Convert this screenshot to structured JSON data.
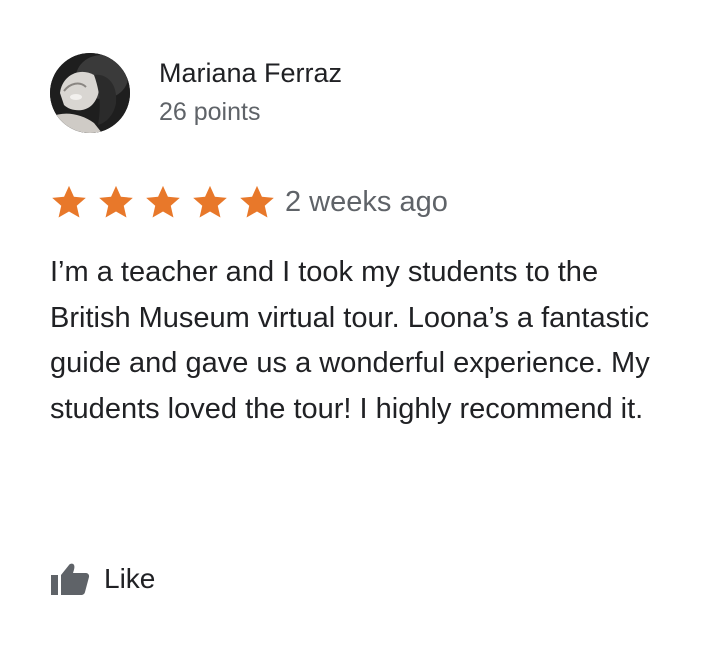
{
  "review": {
    "author": {
      "name": "Mariana Ferraz",
      "points": "26 points",
      "avatar_icon": "user-avatar-photo"
    },
    "rating": {
      "stars": 5,
      "max_stars": 5,
      "star_color": "#e8782a",
      "star_icon": "star-icon"
    },
    "date": "2 weeks ago",
    "text": "I’m a teacher and I took my students to the British Museum virtual tour. Loona’s a fantastic guide and gave us a wonderful experience. My students loved the tour! I highly recommend it.",
    "like": {
      "label": "Like",
      "icon": "thumbs-up-icon"
    }
  },
  "colors": {
    "text_primary": "#202124",
    "text_secondary": "#5f6368",
    "icon_gray": "#5f6368",
    "background": "#ffffff"
  }
}
